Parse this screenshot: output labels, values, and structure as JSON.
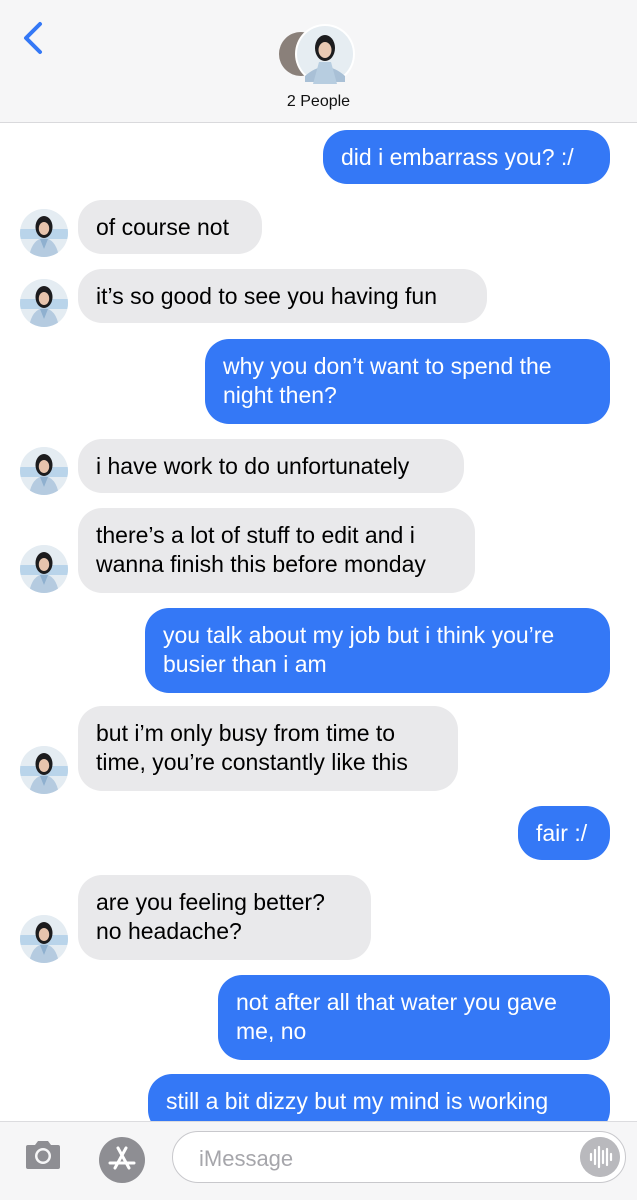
{
  "header": {
    "title": "2 People",
    "back_icon": "chevron-left-icon",
    "accent": "#3478f6"
  },
  "messages": [
    {
      "from": "me",
      "text": "did i embarrass you? :/"
    },
    {
      "from": "them",
      "text": "of course not"
    },
    {
      "from": "them",
      "text": "it’s so good to see you having fun"
    },
    {
      "from": "me",
      "text": "why you don’t want to spend the\nnight then?"
    },
    {
      "from": "them",
      "text": "i have work to do unfortunately"
    },
    {
      "from": "them",
      "text": "there’s a lot of stuff to edit and i\nwanna finish this before monday"
    },
    {
      "from": "me",
      "text": "you talk about my job but i think you’re\nbusier than i am"
    },
    {
      "from": "them",
      "text": "but i’m only busy from time to\ntime, you’re constantly like this"
    },
    {
      "from": "me",
      "text": "fair :/"
    },
    {
      "from": "them",
      "text": "are you feeling better?\nno headache?"
    },
    {
      "from": "me",
      "text": "not after all that water you gave\nme, no"
    },
    {
      "from": "me",
      "text": "still a bit dizzy but my mind is working"
    }
  ],
  "toolbar": {
    "placeholder": "iMessage",
    "camera_icon": "camera-icon",
    "apps_icon": "app-store-icon",
    "audio_icon": "audio-waveform-icon"
  },
  "colors": {
    "outgoing_bubble": "#3478f6",
    "incoming_bubble": "#e9e9eb"
  }
}
